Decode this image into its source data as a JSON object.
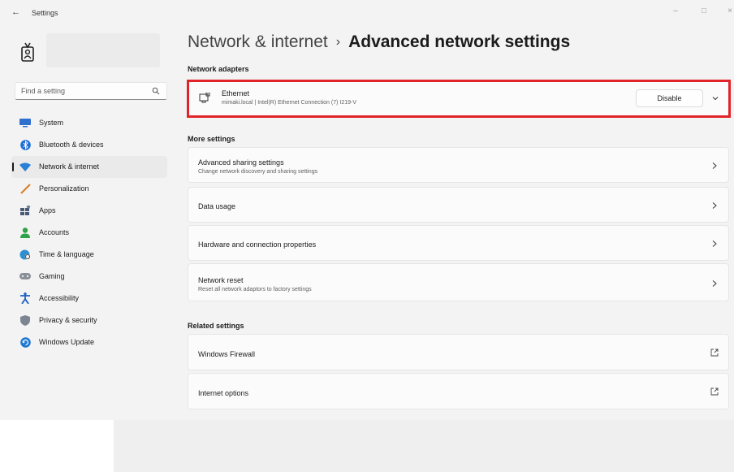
{
  "window": {
    "title": "Settings",
    "back_glyph": "←",
    "controls": {
      "minimize": "–",
      "maximize": "□",
      "close": "×"
    }
  },
  "search": {
    "placeholder": "Find a setting",
    "icon": "search-icon"
  },
  "sidebar": {
    "items": [
      {
        "label": "System",
        "icon": "monitor-icon",
        "color": "#2f6fd0"
      },
      {
        "label": "Bluetooth & devices",
        "icon": "bluetooth-icon",
        "color": "#1f6fd6"
      },
      {
        "label": "Network & internet",
        "icon": "wifi-icon",
        "color": "#2a7fd6",
        "active": true
      },
      {
        "label": "Personalization",
        "icon": "brush-icon",
        "color": "#d9822b"
      },
      {
        "label": "Apps",
        "icon": "apps-icon",
        "color": "#5b6b85"
      },
      {
        "label": "Accounts",
        "icon": "person-icon",
        "color": "#2fa34a"
      },
      {
        "label": "Time & language",
        "icon": "globe-clock-icon",
        "color": "#2c8fd1"
      },
      {
        "label": "Gaming",
        "icon": "gamepad-icon",
        "color": "#8a8f98"
      },
      {
        "label": "Accessibility",
        "icon": "accessibility-icon",
        "color": "#1c5fc4"
      },
      {
        "label": "Privacy & security",
        "icon": "shield-icon",
        "color": "#7c8591"
      },
      {
        "label": "Windows Update",
        "icon": "update-icon",
        "color": "#1f78d1"
      }
    ]
  },
  "breadcrumb": {
    "parent": "Network & internet",
    "separator": "›",
    "current": "Advanced network settings"
  },
  "network_adapters": {
    "heading": "Network adapters",
    "adapter": {
      "name": "Ethernet",
      "description": "mimaki.local | Intel(R) Ethernet Connection (7) I219-V",
      "button": "Disable"
    }
  },
  "more_settings": {
    "heading": "More settings",
    "items": [
      {
        "title": "Advanced sharing settings",
        "subtitle": "Change network discovery and sharing settings"
      },
      {
        "title": "Data usage",
        "subtitle": ""
      },
      {
        "title": "Hardware and connection properties",
        "subtitle": ""
      },
      {
        "title": "Network reset",
        "subtitle": "Reset all network adaptors to factory settings"
      }
    ]
  },
  "related_settings": {
    "heading": "Related settings",
    "items": [
      {
        "title": "Windows Firewall"
      },
      {
        "title": "Internet options"
      }
    ]
  },
  "colors": {
    "highlight_border": "#e0242a",
    "accent": "#0067c0"
  }
}
